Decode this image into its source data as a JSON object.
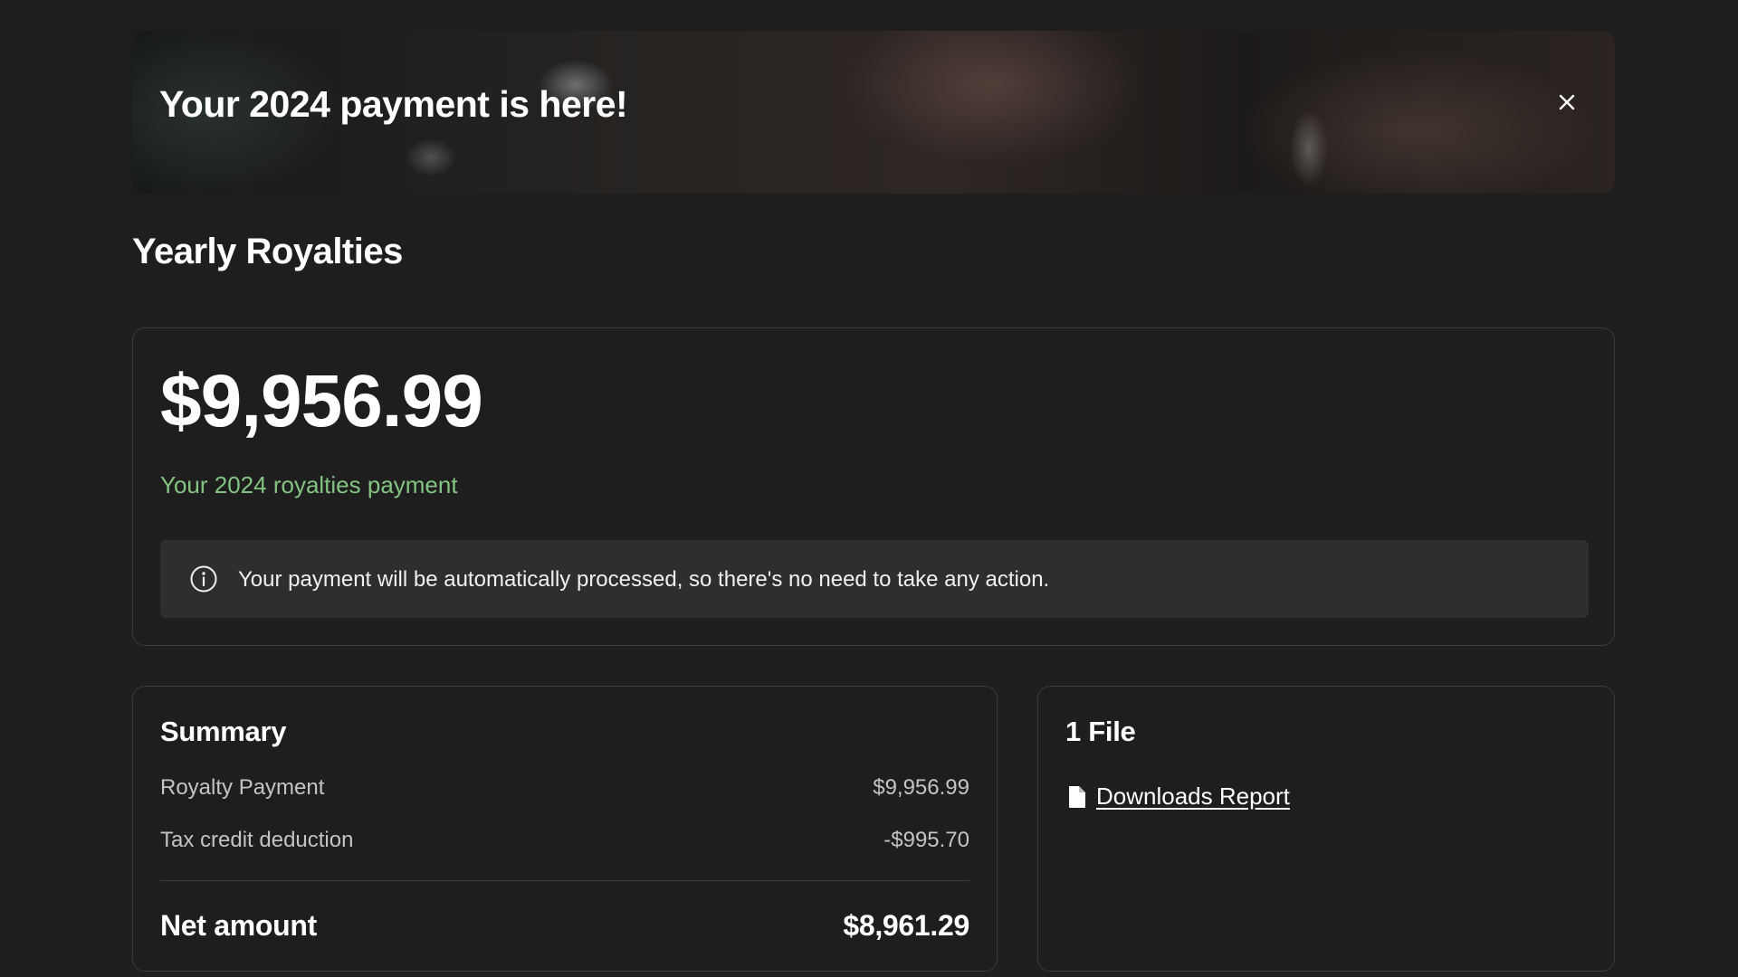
{
  "banner": {
    "title": "Your 2024 payment is here!",
    "close_icon": "close-icon"
  },
  "section": {
    "title": "Yearly Royalties"
  },
  "payment": {
    "amount": "$9,956.99",
    "subtitle": "Your 2024 royalties payment",
    "info_icon": "info-icon",
    "info_text": "Your payment will be automatically processed, so there's no need to take any action."
  },
  "summary": {
    "title": "Summary",
    "rows": [
      {
        "label": "Royalty Payment",
        "value": "$9,956.99"
      },
      {
        "label": "Tax credit deduction",
        "value": "-$995.70"
      }
    ],
    "net_label": "Net amount",
    "net_value": "$8,961.29"
  },
  "files": {
    "title": "1 File",
    "items": [
      {
        "icon": "document-icon",
        "label": "Downloads Report"
      }
    ]
  },
  "colors": {
    "background": "#1e1e1e",
    "accent_green": "#84c482",
    "info_box": "#2e2e2e",
    "border": "#3a3a3a"
  }
}
